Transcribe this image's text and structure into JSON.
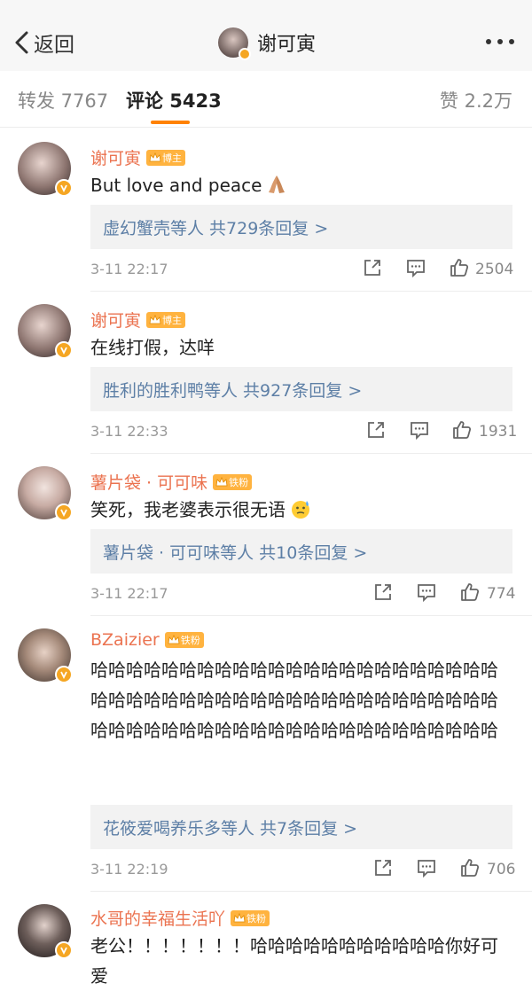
{
  "header": {
    "back_label": "返回",
    "title": "谢可寅"
  },
  "tabs": {
    "forward": "转发 7767",
    "comments": "评论 5423",
    "likes": "赞 2.2万"
  },
  "comments": [
    {
      "name": "谢可寅",
      "tag": "博主",
      "text": "But love and peace",
      "reply": "虚幻蟹壳等人 共729条回复 >",
      "time": "3-11 22:17",
      "likes": "2504"
    },
    {
      "name": "谢可寅",
      "tag": "博主",
      "text": "在线打假，达咩",
      "reply": "胜利的胜利鸭等人 共927条回复 >",
      "time": "3-11 22:33",
      "likes": "1931"
    },
    {
      "name": "薯片袋 · 可可味",
      "tag": "铁粉",
      "text": "笑死，我老婆表示很无语",
      "reply": "薯片袋 · 可可味等人 共10条回复 >",
      "time": "3-11 22:17",
      "likes": "774"
    },
    {
      "name": "BZaizier",
      "tag": "铁粉",
      "text": "哈哈哈哈哈哈哈哈哈哈哈哈哈哈哈哈哈哈哈哈哈哈哈哈哈哈哈哈哈哈哈哈哈哈哈哈哈哈哈哈哈哈哈哈哈哈哈哈哈哈哈哈哈哈哈哈哈哈哈哈哈哈哈哈哈哈哈哈哈",
      "reply": "花筱爱喝养乐多等人 共7条回复 >",
      "time": "3-11 22:19",
      "likes": "706"
    },
    {
      "name": "水哥的幸福生活吖",
      "tag": "铁粉",
      "text": "老公！！！！！！！哈哈哈哈哈哈哈哈哈哈哈你好可爱"
    }
  ],
  "colors": {
    "accent": "#ff8200",
    "name": "#eb7350",
    "link": "#5d7fa6",
    "tag": "#ffb33f"
  }
}
